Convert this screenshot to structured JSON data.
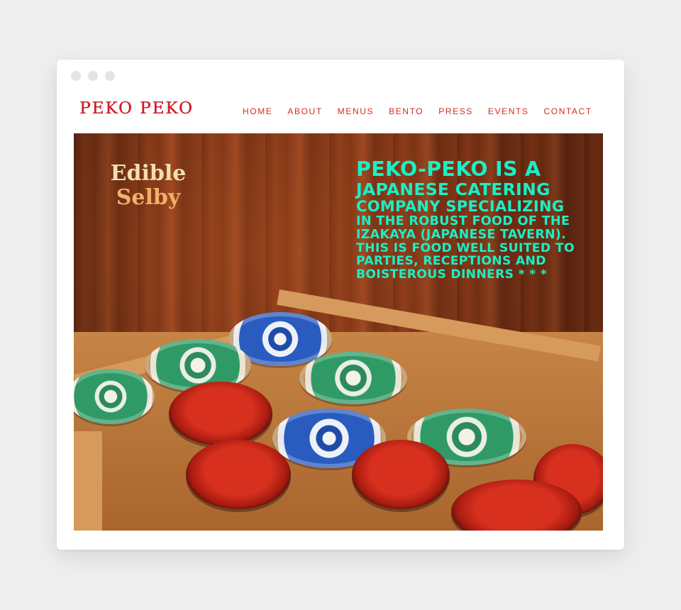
{
  "window": {
    "controls": [
      "close",
      "minimize",
      "maximize"
    ]
  },
  "header": {
    "logo": "PEKO PEKO",
    "nav": [
      "HOME",
      "ABOUT",
      "MENUS",
      "BENTO",
      "PRESS",
      "EVENTS",
      "CONTACT"
    ]
  },
  "hero": {
    "badge_line1": "Edible",
    "badge_line2": "Selby",
    "headline_lines": [
      "PEKO-PEKO IS A",
      "JAPANESE CATERING",
      "COMPANY SPECIALIZING",
      "IN THE ROBUST FOOD OF THE",
      "IZAKAYA (JAPANESE  TAVERN).",
      "THIS IS FOOD WELL SUITED TO",
      "PARTIES, RECEPTIONS AND",
      "BOISTEROUS DINNERS  * * *"
    ]
  },
  "colors": {
    "page_bg": "#eeeeef",
    "logo": "#cf1d2a",
    "nav": "#d62b22",
    "headline": "#18f0c6",
    "badge_line1": "#f2dfae",
    "badge_line2": "#f0b06a"
  }
}
